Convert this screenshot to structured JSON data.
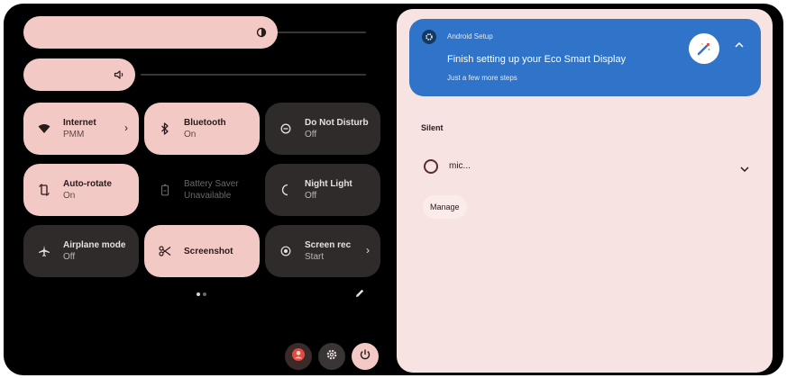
{
  "quick_settings": {
    "brightness": {
      "level_percent": 70
    },
    "volume": {
      "level_percent": 33
    },
    "tiles": [
      {
        "id": "internet",
        "label": "Internet",
        "status": "PMM",
        "state": "on",
        "has_chevron": true,
        "icon": "wifi-icon"
      },
      {
        "id": "bluetooth",
        "label": "Bluetooth",
        "status": "On",
        "state": "on",
        "icon": "bluetooth-icon"
      },
      {
        "id": "dnd",
        "label": "Do Not Disturb",
        "status": "Off",
        "state": "off",
        "icon": "dnd-icon"
      },
      {
        "id": "autorotate",
        "label": "Auto-rotate",
        "status": "On",
        "state": "on",
        "icon": "rotate-icon"
      },
      {
        "id": "battery",
        "label": "Battery Saver",
        "status": "Unavailable",
        "state": "disabled",
        "icon": "battery-icon"
      },
      {
        "id": "nightlight",
        "label": "Night Light",
        "status": "Off",
        "state": "off",
        "icon": "moon-icon"
      },
      {
        "id": "airplane",
        "label": "Airplane mode",
        "status": "Off",
        "state": "off",
        "icon": "airplane-icon"
      },
      {
        "id": "screenshot",
        "label": "Screenshot",
        "status": "",
        "state": "on",
        "icon": "scissors-icon"
      },
      {
        "id": "screenrec",
        "label": "Screen rec",
        "status": "Start",
        "state": "off",
        "has_chevron": true,
        "icon": "record-icon"
      }
    ],
    "chevron": "›"
  },
  "notification": {
    "app_name": "Android Setup",
    "title": "Finish setting up your Eco Smart Display",
    "subtitle": "Just a few more steps"
  },
  "silent_section": {
    "header": "Silent",
    "item_label": "mic...",
    "manage_label": "Manage"
  },
  "colors": {
    "tile_on": "#f3c9c6",
    "tile_off": "#2f2b2b",
    "notification_bg": "#2f74c8",
    "shade_bg": "#f7e3e1",
    "power_button": "#f3c9c6",
    "user_button": "#e04a3f"
  }
}
